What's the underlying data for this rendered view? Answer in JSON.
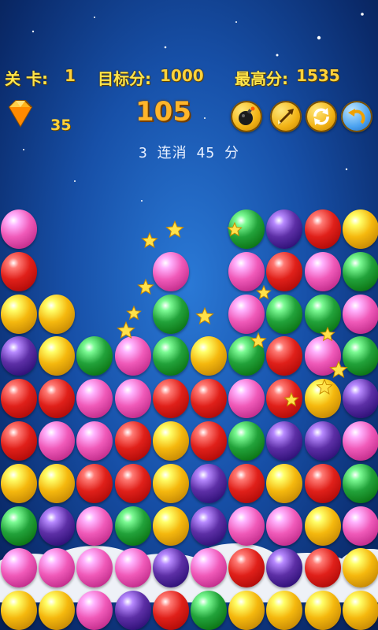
{
  "hud": {
    "level_label": "关  卡:",
    "level_value": "1",
    "target_label": "目标分:",
    "target_value": "1000",
    "best_label": "最高分:",
    "best_value": "1535"
  },
  "gems": {
    "count": "35"
  },
  "score": "105",
  "combo_text": "3 连消 45 分",
  "tools": [
    {
      "name": "bomb-icon"
    },
    {
      "name": "arrow-icon"
    },
    {
      "name": "refresh-icon"
    },
    {
      "name": "undo-icon"
    }
  ],
  "colors": {
    "pink": "#f05ab9",
    "red": "#e0201a",
    "yellow": "#f5b80e",
    "green": "#22a23a",
    "purple": "#5d2fa6"
  },
  "grid": [
    [
      "pink",
      null,
      null,
      null,
      null,
      null,
      "green",
      "purple",
      "red",
      "yellow"
    ],
    [
      "red",
      null,
      null,
      null,
      "pink",
      null,
      "pink",
      "red",
      "pink",
      "green"
    ],
    [
      "yellow",
      "yellow",
      null,
      null,
      null,
      null,
      "pink",
      "green",
      "green",
      "pink"
    ],
    [
      "purple",
      "yellow",
      "green",
      "pink",
      "green",
      "yellow",
      "green",
      "red",
      "pink",
      "green"
    ],
    [
      "red",
      "red",
      "pink",
      "pink",
      "red",
      "red",
      "pink",
      "red",
      "yellow",
      "purple"
    ],
    [
      "red",
      "pink",
      "pink",
      "red",
      "yellow",
      "red",
      "green",
      "purple",
      "purple",
      "pink"
    ],
    [
      "yellow",
      "yellow",
      "red",
      "red",
      "yellow",
      "purple",
      "red",
      "yellow",
      "red",
      "green"
    ],
    [
      "green",
      "purple",
      "pink",
      "green",
      "yellow",
      "purple",
      "pink",
      "pink",
      "yellow",
      "pink"
    ],
    [
      "pink",
      "pink",
      "pink",
      "pink",
      "purple",
      "pink",
      "red",
      "purple",
      "red",
      "yellow"
    ],
    [
      "yellow",
      "yellow",
      "pink",
      "purple",
      "red",
      "green",
      "yellow",
      "yellow",
      "yellow",
      "yellow"
    ]
  ],
  "board_extra": [
    {
      "color": "green",
      "row": 2,
      "col": 4
    }
  ]
}
